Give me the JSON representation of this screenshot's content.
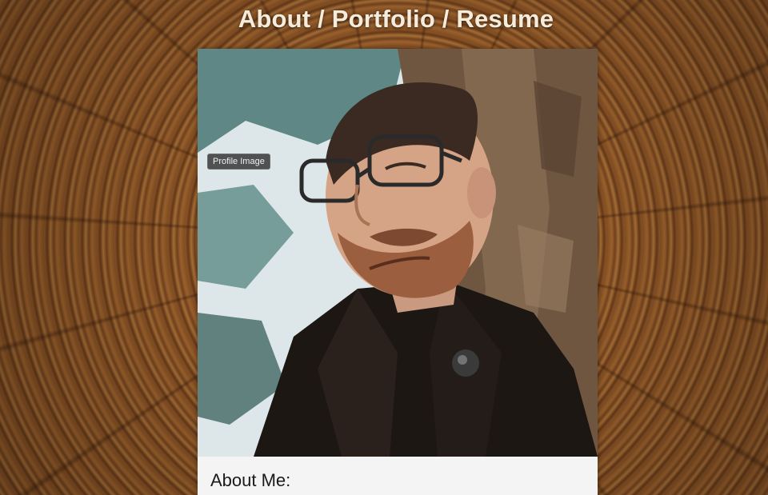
{
  "header": {
    "title": "About / Portfolio / Resume"
  },
  "profile": {
    "image_alt": "Profile Image",
    "tooltip": "Profile Image"
  },
  "about": {
    "heading": "About Me:"
  },
  "colors": {
    "title_text": "#f6ecdc",
    "card_background": "#f4f4f4",
    "wood_light": "#b4773a",
    "wood_dark": "#6d3d1a"
  }
}
